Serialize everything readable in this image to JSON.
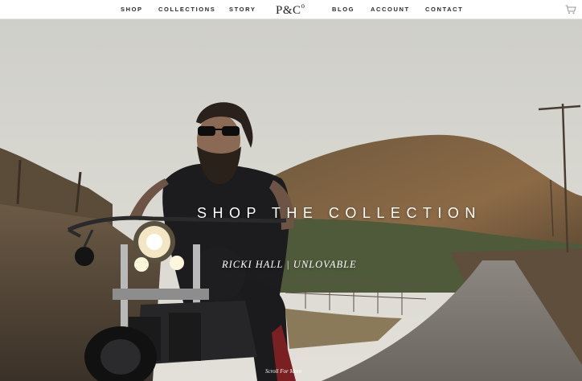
{
  "nav": {
    "shop": "SHOP",
    "collections": "COLLECTIONS",
    "story": "STORY",
    "logo": "P&C",
    "logo_sup": "o",
    "blog": "BLOG",
    "account": "ACCOUNT",
    "contact": "CONTACT",
    "cart_icon": "shopping-cart-icon"
  },
  "hero": {
    "title": "SHOP THE COLLECTION",
    "subtitle": "RICKI HALL | UNLOVABLE",
    "scroll_text": "Scroll For More",
    "slides_count": 6,
    "active_slide_index": 4
  },
  "colors": {
    "nav_bg": "#ffffff",
    "nav_text": "#2a2a2a",
    "hero_text": "#ffffff",
    "sky": "#d9d9d3"
  }
}
